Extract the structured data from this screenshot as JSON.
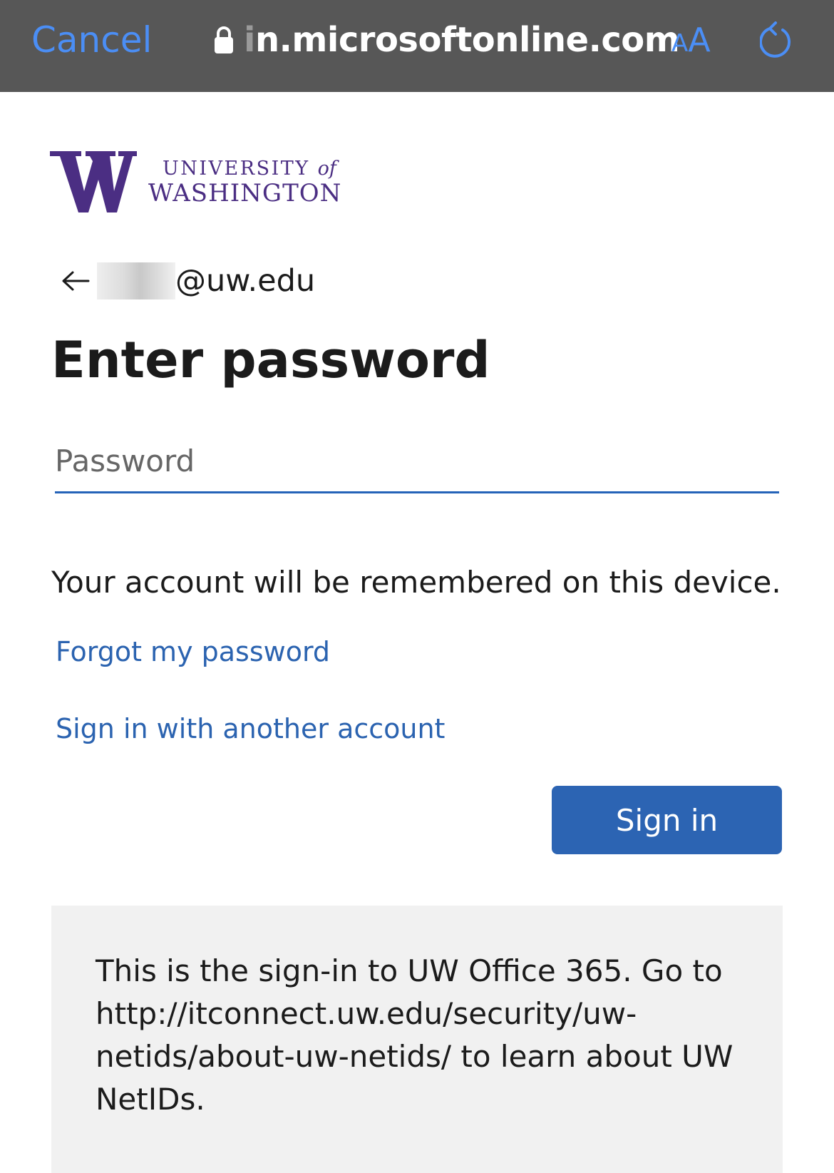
{
  "browser": {
    "cancel_label": "Cancel",
    "url_prefix": "i",
    "url_text": "n.microsoftonline.com",
    "text_size_small": "A",
    "text_size_large": "A",
    "accent_color": "#4b8ef5"
  },
  "logo": {
    "letter": "W",
    "line1": "UNIVERSITY",
    "line1_of": "of",
    "line2": "WASHINGTON",
    "brand_color": "#4b2e83"
  },
  "identity": {
    "email_suffix": "@uw.edu"
  },
  "page": {
    "title": "Enter password",
    "password_placeholder": "Password",
    "remember_text": "Your account will be remembered on this device.",
    "forgot_link": "Forgot my password",
    "another_account_link": "Sign in with another account",
    "signin_button": "Sign in",
    "info_text": "This is the sign-in to UW Office 365. Go to http://itconnect.uw.edu/security/uw-netids/about-uw-netids/ to learn about UW NetIDs."
  },
  "colors": {
    "link": "#2b63b0",
    "button": "#2c64b3",
    "toolbar": "#575757",
    "info_background": "#f1f1f1"
  }
}
